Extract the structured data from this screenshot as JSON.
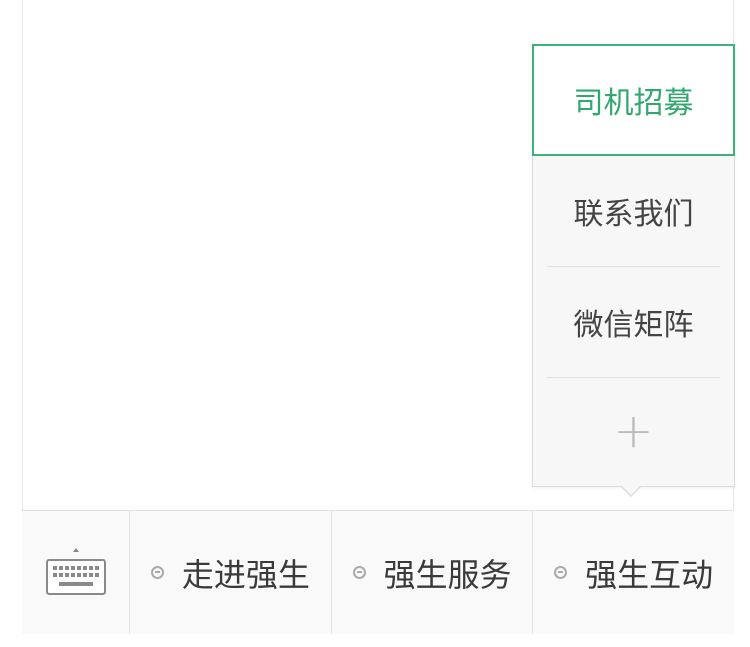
{
  "submenu": {
    "items": [
      {
        "label": "司机招募",
        "active": true
      },
      {
        "label": "联系我们",
        "active": false
      },
      {
        "label": "微信矩阵",
        "active": false
      }
    ],
    "add_label": "+"
  },
  "menubar": {
    "keyboard_icon": "keyboard-icon",
    "tabs": [
      {
        "label": "走进强生",
        "icon": "menu-dot-icon"
      },
      {
        "label": "强生服务",
        "icon": "menu-dot-icon"
      },
      {
        "label": "强生互动",
        "icon": "menu-dot-icon"
      }
    ]
  },
  "colors": {
    "accent": "#31a86e",
    "border": "#e3e3e3",
    "bar_bg": "#f9f9f9"
  }
}
